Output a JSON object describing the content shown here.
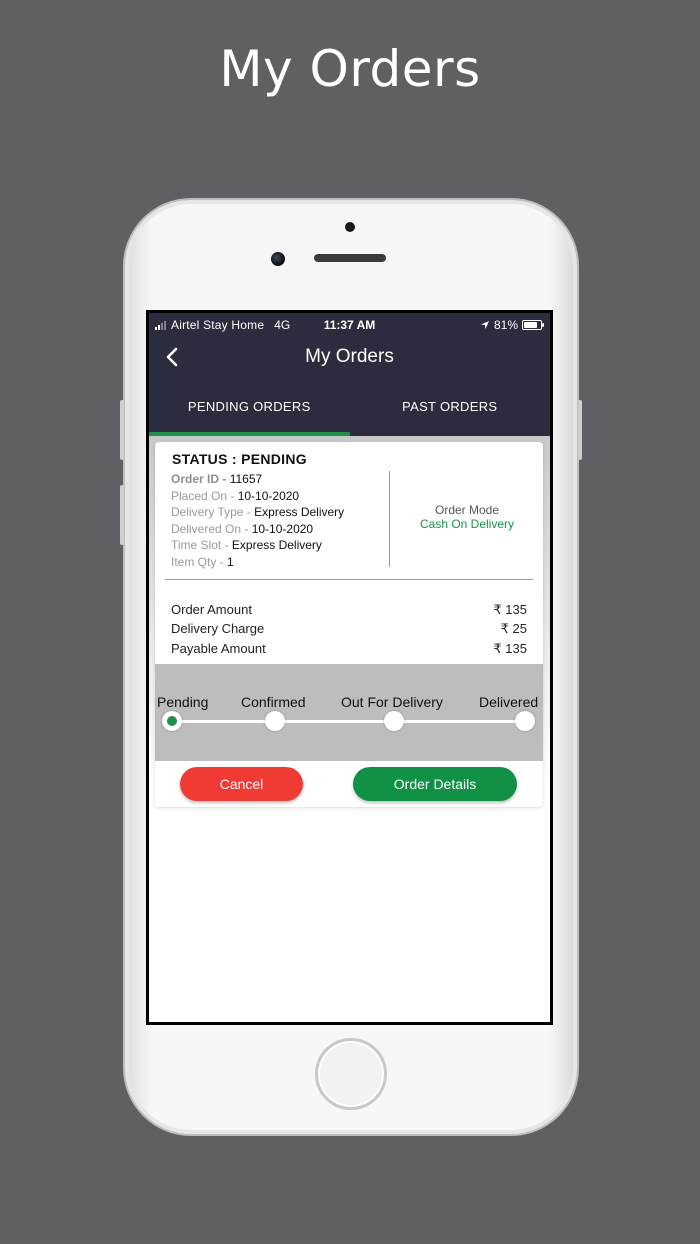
{
  "promo": {
    "title": "My Orders"
  },
  "status_bar": {
    "carrier": "Airtel Stay Home",
    "network": "4G",
    "time": "11:37 AM",
    "battery": "81%",
    "battery_level": 0.81
  },
  "nav": {
    "title": "My Orders"
  },
  "tabs": [
    {
      "label": "PENDING ORDERS",
      "active": true
    },
    {
      "label": "PAST ORDERS",
      "active": false
    }
  ],
  "order": {
    "status": "STATUS : PENDING",
    "order_id_label": "Order ID - ",
    "order_id": "11657",
    "placed_on_label": "Placed On - ",
    "placed_on": "10-10-2020",
    "delivery_type_label": "Delivery Type - ",
    "delivery_type": "Express Delivery",
    "delivered_on_label": "Delivered On - ",
    "delivered_on": "10-10-2020",
    "time_slot_label": "Time Slot - ",
    "time_slot": "Express Delivery",
    "item_qty_label": "Item Qty - ",
    "item_qty": "1",
    "order_mode_label": "Order Mode",
    "order_mode": "Cash On Delivery"
  },
  "amounts": [
    {
      "label": "Order Amount",
      "value": "₹ 135"
    },
    {
      "label": "Delivery Charge",
      "value": "₹ 25"
    },
    {
      "label": "Payable Amount",
      "value": "₹ 135"
    }
  ],
  "tracker": {
    "steps": [
      "Pending",
      "Confirmed",
      "Out For Delivery",
      "Delivered"
    ],
    "current_step": "Pending"
  },
  "buttons": {
    "cancel": "Cancel",
    "details": "Order Details"
  },
  "colors": {
    "header": "#2b2d3e",
    "accent_green": "#1e9146",
    "cancel_red": "#f03a34",
    "background": "#5f6064"
  }
}
